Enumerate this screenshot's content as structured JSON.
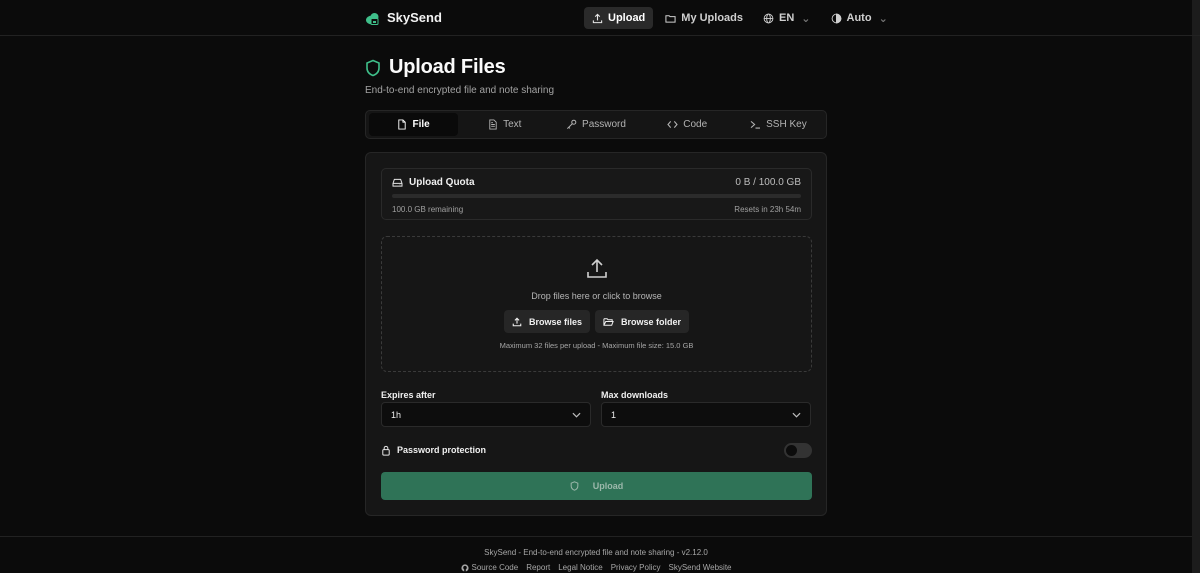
{
  "brand": {
    "name": "SkySend",
    "accent": "#3fbf8a"
  },
  "nav": {
    "upload": "Upload",
    "my_uploads": "My Uploads",
    "language": "EN",
    "theme": "Auto"
  },
  "page": {
    "title": "Upload Files",
    "subtitle": "End-to-end encrypted file and note sharing"
  },
  "tabs": [
    {
      "label": "File",
      "icon": "file-icon",
      "active": true
    },
    {
      "label": "Text",
      "icon": "file-text-icon",
      "active": false
    },
    {
      "label": "Password",
      "icon": "key-icon",
      "active": false
    },
    {
      "label": "Code",
      "icon": "code-icon",
      "active": false
    },
    {
      "label": "SSH Key",
      "icon": "terminal-icon",
      "active": false
    }
  ],
  "quota": {
    "title": "Upload Quota",
    "usage": "0 B / 100.0 GB",
    "used_fraction": 0,
    "remaining": "100.0 GB remaining",
    "resets": "Resets in 23h 54m"
  },
  "dropzone": {
    "text": "Drop files here or click to browse",
    "browse_files": "Browse files",
    "browse_folder": "Browse folder",
    "limit": "Maximum 32 files per upload - Maximum file size: 15.0 GB"
  },
  "options": {
    "expires_label": "Expires after",
    "expires_value": "1h",
    "max_downloads_label": "Max downloads",
    "max_downloads_value": "1",
    "password_label": "Password protection",
    "password_enabled": false
  },
  "upload_button": {
    "label": "Upload",
    "color": "#2f7357"
  },
  "footer": {
    "line": "SkySend - End-to-end encrypted file and note sharing - v2.12.0",
    "links": [
      "Source Code",
      "Report",
      "Legal Notice",
      "Privacy Policy",
      "SkySend Website"
    ]
  }
}
